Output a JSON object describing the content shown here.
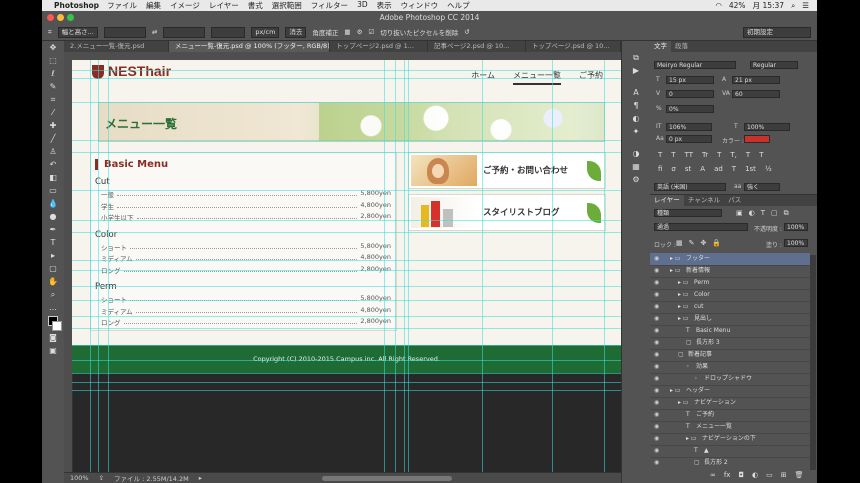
{
  "menubar": {
    "app_name": "Photoshop",
    "items": [
      "ファイル",
      "編集",
      "イメージ",
      "レイヤー",
      "書式",
      "選択範囲",
      "フィルター",
      "3D",
      "表示",
      "ウィンドウ",
      "ヘルプ"
    ],
    "battery": "42%",
    "clock": "月 15:37"
  },
  "window": {
    "title": "Adobe Photoshop CC 2014"
  },
  "options_bar": {
    "preset": "幅と高さ...",
    "unit": "px/cm",
    "clear_label": "消去",
    "straighten_label": "角度補正",
    "delete_cropped_label": "切り抜いたピクセルを削除",
    "workspace": "初期設定"
  },
  "tabs": [
    {
      "label": "2.メニュー一覧-復元.psd",
      "active": false
    },
    {
      "label": "メニュー一覧-復元.psd @ 100% (フッター, RGB/8) *",
      "active": true
    },
    {
      "label": "トップページ2.psd @ 1...",
      "active": false
    },
    {
      "label": "記事ページ2.psd @ 10...",
      "active": false
    },
    {
      "label": "トップページ.psd @ 10...",
      "active": false
    }
  ],
  "site": {
    "brand": "NESThair",
    "nav": [
      "ホーム",
      "メニュー一覧",
      "ご予約"
    ],
    "hero_title": "メニュー一覧",
    "menu_heading": "Basic Menu",
    "categories": [
      {
        "name": "Cut",
        "items": [
          [
            "一般",
            "5,800yen"
          ],
          [
            "学生",
            "4,800yen"
          ],
          [
            "小学生以下",
            "2,800yen"
          ]
        ]
      },
      {
        "name": "Color",
        "items": [
          [
            "ショート",
            "5,800yen"
          ],
          [
            "ミディアム",
            "4,800yen"
          ],
          [
            "ロング",
            "2,800yen"
          ]
        ]
      },
      {
        "name": "Perm",
        "items": [
          [
            "ショート",
            "5,800yen"
          ],
          [
            "ミディアム",
            "4,800yen"
          ],
          [
            "ロング",
            "2,800yen"
          ]
        ]
      }
    ],
    "side_cards": [
      "ご予約・お問い合わせ",
      "スタイリストブログ"
    ],
    "footer": "Copyright (C) 2010-2015 Campus inc. All Right Reserved."
  },
  "status": {
    "zoom": "100%",
    "file": "ファイル : 2.55M/14.2M"
  },
  "character_panel": {
    "tabs": [
      "文字",
      "段落"
    ],
    "font": "Meiryo Regular",
    "style": "Regular",
    "size": "15 px",
    "leading": "21 px",
    "kerning": "0",
    "tracking": "60",
    "tsume": "0%",
    "vscale": "106%",
    "hscale": "100%",
    "baseline": "0 px",
    "color_label": "カラー :",
    "language": "英語 (米国)",
    "antialias": "強く",
    "type_styles": [
      "T",
      "T",
      "TT",
      "Tr",
      "T",
      "T,",
      "T",
      "T"
    ],
    "extra_styles": [
      "fi",
      "σ",
      "st",
      "A",
      "ad",
      "T",
      "1st",
      "½"
    ]
  },
  "layers_panel": {
    "tabs": [
      "レイヤー",
      "チャンネル",
      "パス"
    ],
    "filter": "種類",
    "blend": "通過",
    "opacity_label": "不透明度 :",
    "opacity": "100%",
    "lock_label": "ロック :",
    "fill_label": "塗り :",
    "fill": "100%",
    "layers": [
      {
        "name": "フッター",
        "indent": 0,
        "kind": "folder",
        "selected": true
      },
      {
        "name": "新着情報",
        "indent": 0,
        "kind": "folder",
        "selected": false
      },
      {
        "name": "Perm",
        "indent": 1,
        "kind": "folder",
        "selected": false
      },
      {
        "name": "Color",
        "indent": 1,
        "kind": "folder",
        "selected": false
      },
      {
        "name": "cut",
        "indent": 1,
        "kind": "folder",
        "selected": false
      },
      {
        "name": "見出し",
        "indent": 1,
        "kind": "folder",
        "selected": false
      },
      {
        "name": "Basic Menu",
        "indent": 2,
        "kind": "text",
        "selected": false
      },
      {
        "name": "長方形 3",
        "indent": 2,
        "kind": "shape",
        "selected": false
      },
      {
        "name": "新着記事",
        "indent": 1,
        "kind": "shape",
        "selected": false
      },
      {
        "name": "効果",
        "indent": 2,
        "kind": "fx",
        "selected": false
      },
      {
        "name": "ドロップシャドウ",
        "indent": 3,
        "kind": "fx",
        "selected": false
      },
      {
        "name": "ヘッダー",
        "indent": 0,
        "kind": "folder",
        "selected": false
      },
      {
        "name": "ナビゲーション",
        "indent": 1,
        "kind": "folder",
        "selected": false
      },
      {
        "name": "ご予約",
        "indent": 2,
        "kind": "text",
        "selected": false
      },
      {
        "name": "メニュー一覧",
        "indent": 2,
        "kind": "text",
        "selected": false
      },
      {
        "name": "ナビゲーションの下",
        "indent": 2,
        "kind": "folder",
        "selected": false
      },
      {
        "name": "▲",
        "indent": 3,
        "kind": "text",
        "selected": false
      },
      {
        "name": "長方形 2",
        "indent": 3,
        "kind": "shape",
        "selected": false
      }
    ]
  },
  "colors": {
    "brand": "#8b2b22",
    "green": "#1e6b34",
    "guides": "#36e0e0",
    "panel": "#535353"
  }
}
